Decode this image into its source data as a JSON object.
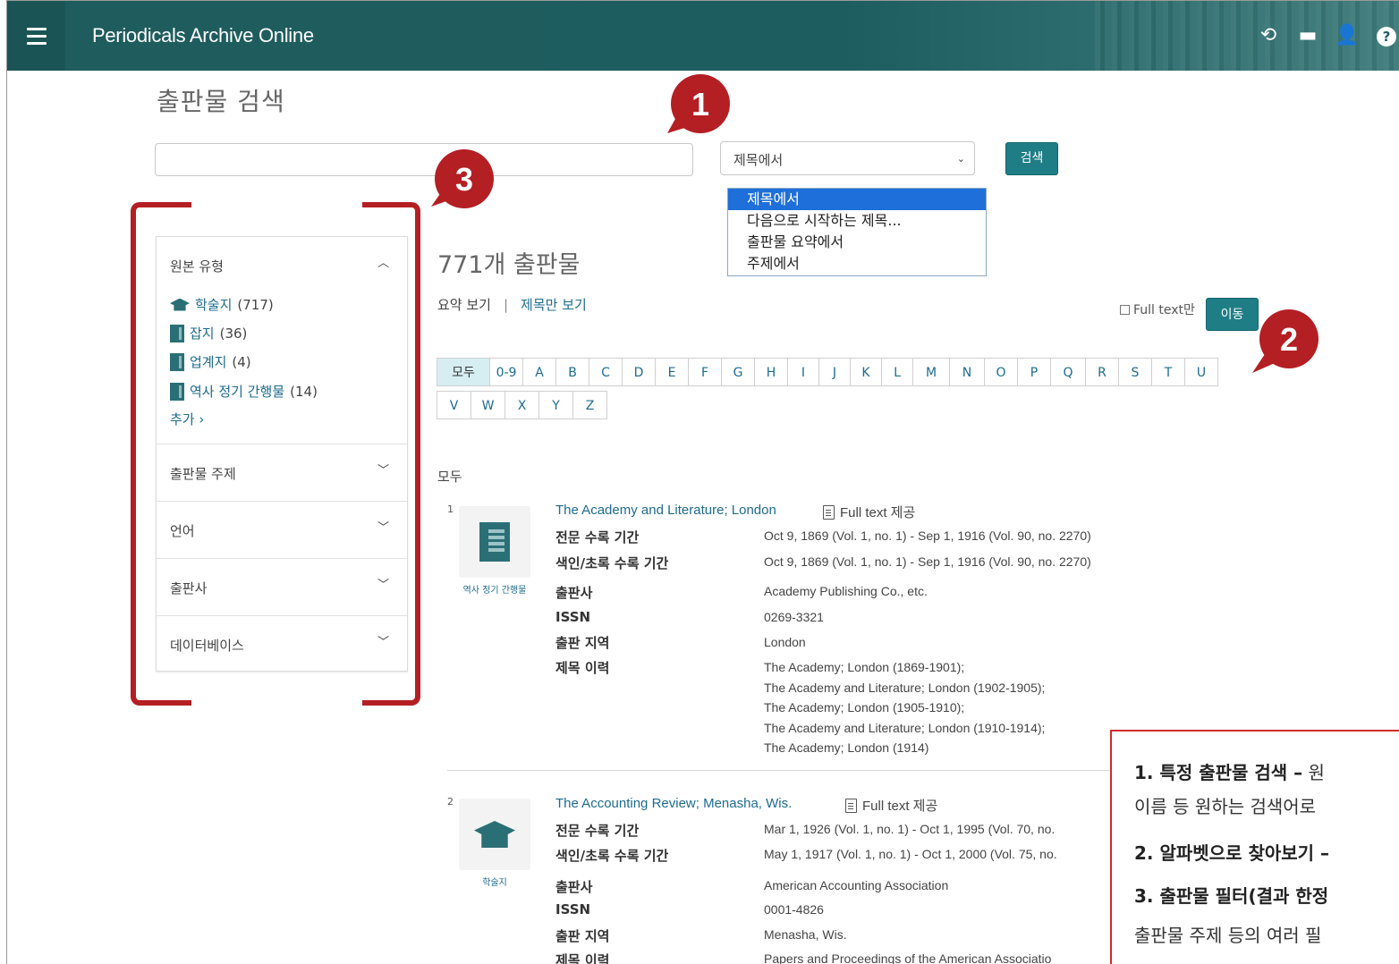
{
  "header": {
    "app_title": "Periodicals Archive Online",
    "icons": [
      "history-icon",
      "folder-icon",
      "user-icon",
      "help-icon"
    ]
  },
  "page_title": "출판물 검색",
  "search": {
    "value": "",
    "select_value": "제목에서",
    "button_label": "검색",
    "options": [
      "제목에서",
      "다음으로 시작하는 제목...",
      "출판물 요약에서",
      "주제에서"
    ]
  },
  "badges": {
    "one": "1",
    "two": "2",
    "three": "3"
  },
  "filters": {
    "source_type": {
      "title": "원본 유형",
      "items": [
        {
          "label": "학술지",
          "count": "(717)",
          "icon": "graduation-cap-icon"
        },
        {
          "label": "잡지",
          "count": "(36)",
          "icon": "magazine-icon"
        },
        {
          "label": "업계지",
          "count": "(4)",
          "icon": "trade-journal-icon"
        },
        {
          "label": "역사 정기 간행물",
          "count": "(14)",
          "icon": "historical-periodical-icon"
        }
      ],
      "more": "추가 ›"
    },
    "sections": [
      "출판물 주제",
      "언어",
      "출판사",
      "데이터베이스"
    ]
  },
  "results": {
    "count_text": "771개 출판물",
    "view_summary": "요약 보기",
    "separator": "|",
    "view_titles": "제목만 보기",
    "full_text_only": "Full text만",
    "go_button": "이동",
    "alphabet_row1": [
      "모두",
      "0-9",
      "A",
      "B",
      "C",
      "D",
      "E",
      "F",
      "G",
      "H",
      "I",
      "J",
      "K",
      "L",
      "M",
      "N",
      "O",
      "P",
      "Q",
      "R",
      "S",
      "T",
      "U"
    ],
    "alphabet_row2": [
      "V",
      "W",
      "X",
      "Y",
      "Z"
    ],
    "section_label": "모두",
    "labels": {
      "full_text_period": "전문 수록 기간",
      "index_period": "색인/초록 수록 기간",
      "publisher": "출판사",
      "issn": "ISSN",
      "place": "출판 지역",
      "title_history": "제목 이력"
    },
    "records": [
      {
        "num": "1",
        "type_label": "역사 정기 간행물",
        "title": "The Academy and Literature; London",
        "full_text": "Full text 제공",
        "full_text_period": "Oct 9, 1869 (Vol. 1, no. 1) - Sep 1, 1916 (Vol. 90, no. 2270)",
        "index_period": "Oct 9, 1869 (Vol. 1, no. 1) - Sep 1, 1916 (Vol. 90, no. 2270)",
        "publisher": "Academy Publishing Co., etc.",
        "issn": "0269-3321",
        "place": "London",
        "title_history": [
          "The Academy; London (1869-1901);",
          "The Academy and Literature; London (1902-1905);",
          "The Academy; London (1905-1910);",
          "The Academy and Literature; London (1910-1914);",
          "The Academy; London (1914)"
        ]
      },
      {
        "num": "2",
        "type_label": "학술지",
        "title": "The Accounting Review; Menasha, Wis.",
        "full_text": "Full text 제공",
        "full_text_period": "Mar 1, 1926 (Vol. 1, no. 1) - Oct 1, 1995 (Vol. 70, no.",
        "index_period": "May 1, 1917 (Vol. 1, no. 1) - Oct 1, 2000 (Vol. 75, no.",
        "publisher": "American Accounting Association",
        "issn": "0001-4826",
        "place": "Menasha, Wis.",
        "title_history": [
          "Papers and Proceedings of the American Associatio"
        ]
      }
    ]
  },
  "annotation": {
    "line1_bold": "1. 특정 출판물 검색 –",
    "line1_rest": " 원",
    "line2": "이름 등 원하는 검색어로",
    "line3_bold": "2. 알파벳으로 찾아보기 –",
    "line4_bold": "3. 출판물 필터(결과 한정",
    "line5": "출판물 주제 등의 여러 필"
  },
  "colors": {
    "header": "#1f5c5e",
    "accent": "#1f7d85",
    "link": "#1d6b8f",
    "badge": "#b41f24"
  }
}
